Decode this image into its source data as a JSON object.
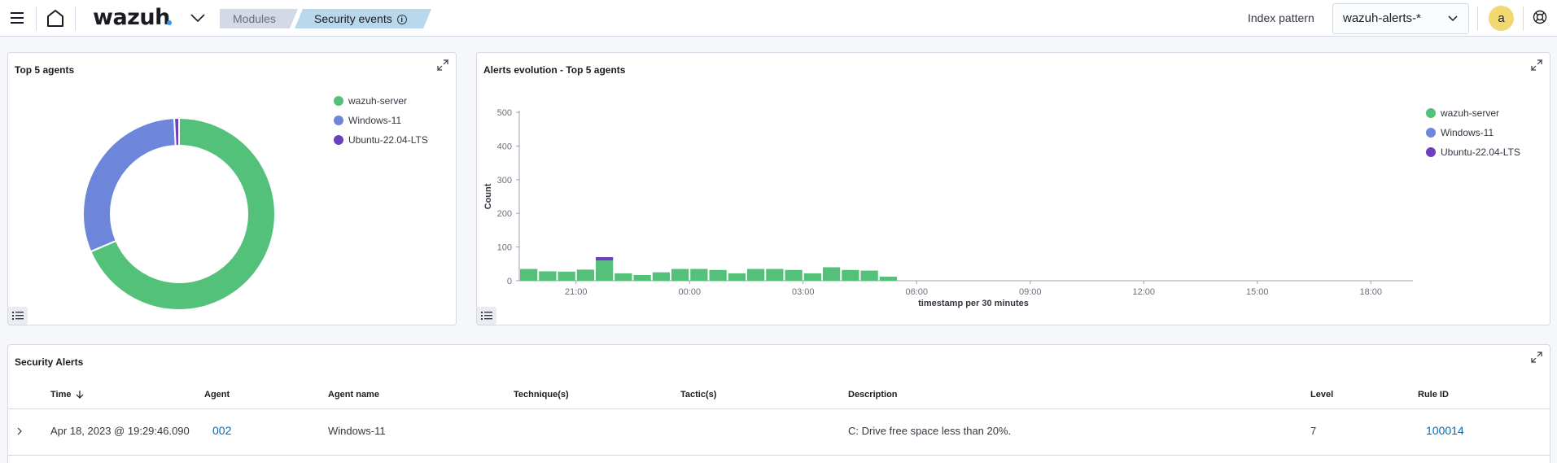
{
  "header": {
    "logo_text": "wazuh",
    "breadcrumbs": [
      "Modules",
      "Security events"
    ],
    "index_pattern_label": "Index pattern",
    "index_pattern_value": "wazuh-alerts-*",
    "avatar_initial": "a"
  },
  "colors": {
    "wazuh-server": "#54c17a",
    "Windows-11": "#6e86d9",
    "Ubuntu-22.04-LTS": "#6c3fbf"
  },
  "top_agents": {
    "title": "Top 5 agents",
    "legend": [
      "wazuh-server",
      "Windows-11",
      "Ubuntu-22.04-LTS"
    ],
    "chart_data": {
      "type": "pie",
      "labels": [
        "wazuh-server",
        "Windows-11",
        "Ubuntu-22.04-LTS"
      ],
      "values": [
        68.6,
        30.6,
        0.8
      ],
      "donut": true
    }
  },
  "alerts_evolution": {
    "title": "Alerts evolution - Top 5 agents",
    "legend": [
      "wazuh-server",
      "Windows-11",
      "Ubuntu-22.04-LTS"
    ],
    "chart_data": {
      "type": "bar",
      "stacked": true,
      "xlabel": "timestamp per 30 minutes",
      "ylabel": "Count",
      "ylim": [
        0,
        500
      ],
      "yticks": [
        0,
        100,
        200,
        300,
        400,
        500
      ],
      "xticks": [
        "21:00",
        "00:00",
        "03:00",
        "06:00",
        "09:00",
        "12:00",
        "15:00",
        "18:00"
      ],
      "x": [
        "19:30",
        "20:00",
        "20:30",
        "21:00",
        "21:30",
        "22:00",
        "22:30",
        "23:00",
        "23:30",
        "00:00",
        "00:30",
        "01:00",
        "01:30",
        "02:00",
        "02:30",
        "03:00",
        "03:30",
        "04:00",
        "04:30",
        "05:00",
        "05:30",
        "06:00",
        "06:30",
        "07:00",
        "07:30",
        "08:00",
        "08:30",
        "09:00",
        "09:30",
        "10:00",
        "10:30",
        "11:00",
        "11:30",
        "12:00",
        "12:30",
        "13:00",
        "13:30",
        "14:00",
        "14:30",
        "15:00",
        "15:30",
        "16:00",
        "16:30",
        "17:00",
        "17:30",
        "18:00",
        "18:30",
        "19:00"
      ],
      "series": [
        {
          "name": "wazuh-server",
          "values": [
            35,
            28,
            27,
            33,
            60,
            22,
            17,
            25,
            35,
            35,
            32,
            22,
            35,
            35,
            32,
            22,
            40,
            32,
            30,
            12,
            0,
            0,
            0,
            0,
            0,
            0,
            0,
            0,
            0,
            0,
            0,
            0,
            0,
            0,
            0,
            0,
            0,
            0,
            0,
            0,
            0,
            0,
            0,
            0,
            0,
            0,
            0,
            0
          ]
        },
        {
          "name": "Windows-11",
          "values": [
            0,
            0,
            0,
            0,
            0,
            0,
            0,
            0,
            0,
            0,
            0,
            0,
            0,
            0,
            0,
            0,
            0,
            0,
            0,
            0,
            0,
            0,
            0,
            0,
            0,
            0,
            0,
            0,
            0,
            0,
            0,
            0,
            0,
            0,
            0,
            0,
            0,
            0,
            0,
            0,
            0,
            0,
            0,
            0,
            0,
            0,
            0,
            0
          ]
        },
        {
          "name": "Ubuntu-22.04-LTS",
          "values": [
            0,
            0,
            0,
            0,
            10,
            0,
            0,
            0,
            0,
            0,
            0,
            0,
            0,
            0,
            0,
            0,
            0,
            0,
            0,
            0,
            0,
            0,
            0,
            0,
            0,
            0,
            0,
            0,
            0,
            0,
            0,
            0,
            0,
            0,
            0,
            0,
            0,
            0,
            0,
            0,
            0,
            0,
            0,
            0,
            0,
            0,
            0,
            0
          ]
        }
      ]
    }
  },
  "security_alerts": {
    "title": "Security Alerts",
    "columns": [
      "Time",
      "Agent",
      "Agent name",
      "Technique(s)",
      "Tactic(s)",
      "Description",
      "Level",
      "Rule ID"
    ],
    "rows": [
      {
        "time": "Apr 18, 2023 @ 19:29:46.090",
        "agent": "002",
        "agent_name": "Windows-11",
        "techniques": "",
        "tactics": "",
        "description": "C: Drive free space less than 20%.",
        "level": "7",
        "rule_id": "100014"
      }
    ]
  }
}
